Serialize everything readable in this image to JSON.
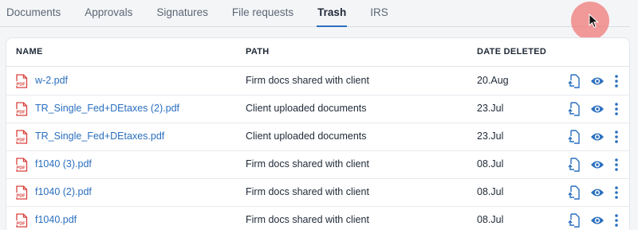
{
  "tabs": [
    {
      "label": "Documents",
      "active": false
    },
    {
      "label": "Approvals",
      "active": false
    },
    {
      "label": "Signatures",
      "active": false
    },
    {
      "label": "File requests",
      "active": false
    },
    {
      "label": "Trash",
      "active": true
    },
    {
      "label": "IRS",
      "active": false
    }
  ],
  "table": {
    "columns": {
      "name": "NAME",
      "path": "PATH",
      "date_deleted": "DATE DELETED"
    },
    "rows": [
      {
        "name": "w-2.pdf",
        "path": "Firm docs shared with client",
        "date": "20.Aug"
      },
      {
        "name": "TR_Single_Fed+DEtaxes (2).pdf",
        "path": "Client uploaded documents",
        "date": "23.Jul"
      },
      {
        "name": "TR_Single_Fed+DEtaxes.pdf",
        "path": "Client uploaded documents",
        "date": "23.Jul"
      },
      {
        "name": "f1040 (3).pdf",
        "path": "Firm docs shared with client",
        "date": "08.Jul"
      },
      {
        "name": "f1040 (2).pdf",
        "path": "Firm docs shared with client",
        "date": "08.Jul"
      },
      {
        "name": "f1040.pdf",
        "path": "Firm docs shared with client",
        "date": "08.Jul"
      }
    ]
  },
  "icons": {
    "file": "pdf-file-icon",
    "restore": "restore-icon",
    "view": "eye-icon",
    "more": "more-vertical-icon"
  },
  "colors": {
    "accent": "#2a6fbf",
    "pdf_red": "#d9413b",
    "cursor_highlight": "#f07878"
  }
}
